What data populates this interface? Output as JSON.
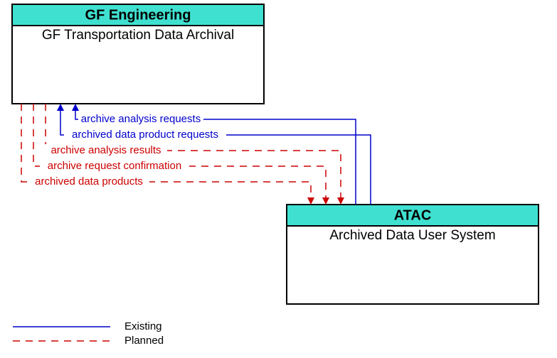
{
  "boxes": {
    "left": {
      "header": "GF Engineering",
      "title": "GF Transportation Data Archival"
    },
    "right": {
      "header": "ATAC",
      "title": "Archived Data User System"
    }
  },
  "flows": {
    "f1": "archive analysis requests",
    "f2": "archived data product requests",
    "f3": "archive analysis results",
    "f4": "archive request confirmation",
    "f5": "archived data products"
  },
  "legend": {
    "existing": "Existing",
    "planned": "Planned"
  },
  "colors": {
    "header": "#40e0d0",
    "existing": "#0000cc",
    "planned": "#cc0000"
  }
}
